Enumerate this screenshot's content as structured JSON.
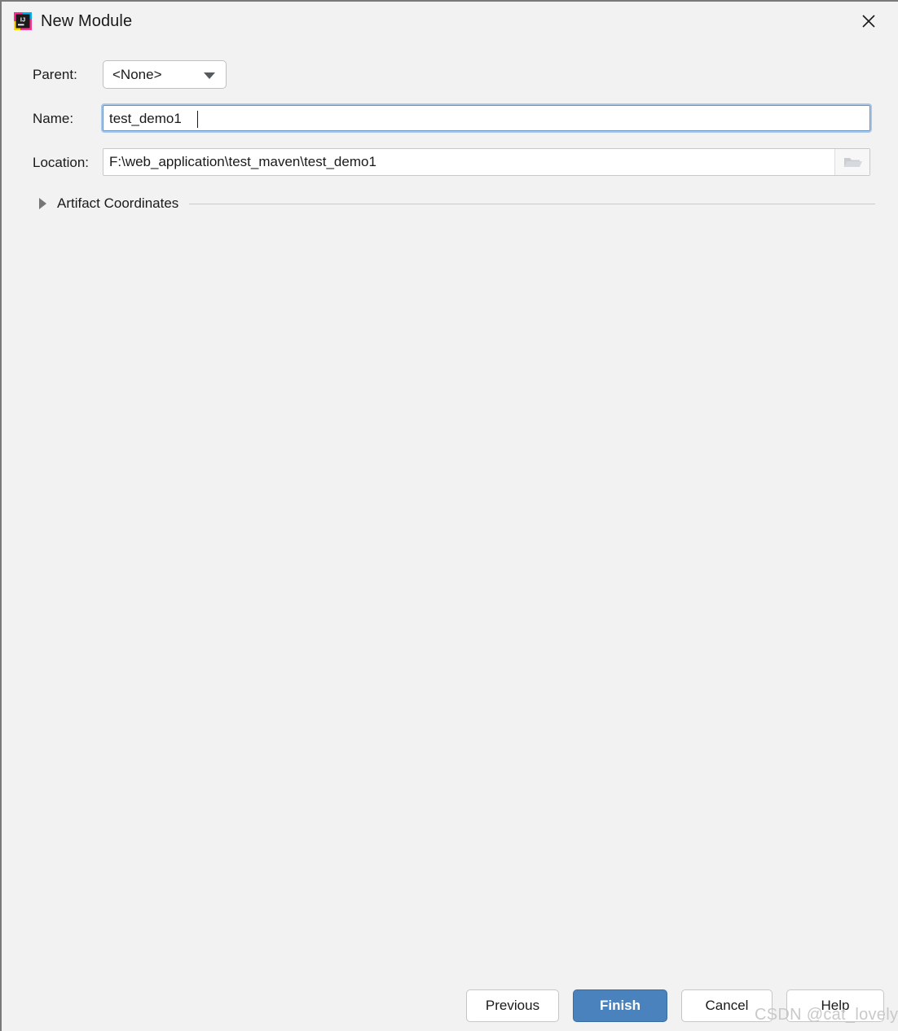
{
  "window": {
    "title": "New Module",
    "app_icon": "intellij-idea-icon",
    "close_icon": "close-icon",
    "background_color": "#f2f2f2"
  },
  "form": {
    "parent": {
      "label": "Parent:",
      "value": "<None>",
      "dropdown_icon": "chevron-down-icon"
    },
    "name": {
      "label": "Name:",
      "value": "test_demo1",
      "focused": true
    },
    "location": {
      "label": "Location:",
      "value": "F:\\web_application\\test_maven\\test_demo1",
      "browse_icon": "folder-icon"
    }
  },
  "artifact_section": {
    "label": "Artifact Coordinates",
    "expanded": false,
    "arrow_icon": "triangle-right-icon"
  },
  "buttons": {
    "previous": "Previous",
    "finish": "Finish",
    "cancel": "Cancel",
    "help": "Help",
    "primary_color": "#4a82bd"
  },
  "watermark": {
    "text": "CSDN @cat_lovely"
  }
}
